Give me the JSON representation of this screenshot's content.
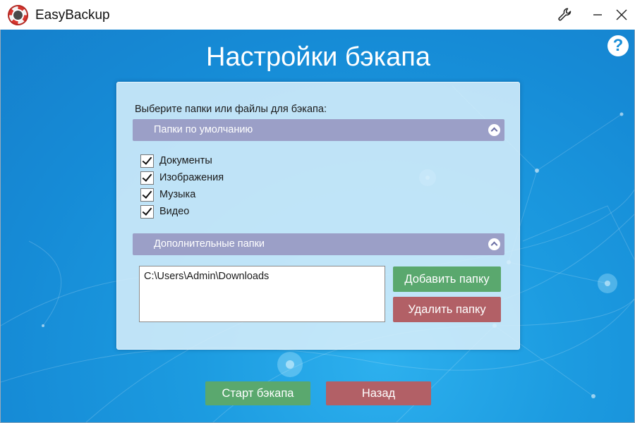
{
  "window": {
    "title": "EasyBackup"
  },
  "page": {
    "heading": "Настройки бэкапа",
    "help_label": "?"
  },
  "panel": {
    "prompt": "Выберите папки или файлы для бэкапа:",
    "default_section": {
      "title": "Папки по умолчанию",
      "items": [
        {
          "label": "Документы",
          "checked": true
        },
        {
          "label": "Изображения",
          "checked": true
        },
        {
          "label": "Музыка",
          "checked": true
        },
        {
          "label": "Видео",
          "checked": true
        }
      ]
    },
    "extra_section": {
      "title": "Дополнительные папки",
      "folders": [
        "C:\\Users\\Admin\\Downloads"
      ],
      "add_label": "Добавить папку",
      "remove_label": "Удалить папку"
    }
  },
  "footer": {
    "start_label": "Старт бэкапа",
    "back_label": "Назад"
  },
  "colors": {
    "background": "#1a93dc",
    "section_header": "#9b9fc7",
    "green_button": "#5aa86e",
    "red_button": "#b26066"
  },
  "icons": {
    "app": "lifebuoy-icon",
    "settings": "wrench-icon",
    "minimize": "minimize-icon",
    "close": "close-icon",
    "help": "help-icon",
    "collapse": "chevron-up-icon"
  }
}
